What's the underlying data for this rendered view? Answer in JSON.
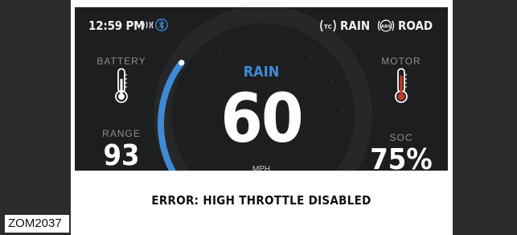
{
  "figure_id": "ZOM2037",
  "status_bar": {
    "time": "12:59 PM",
    "icons": [
      "heated-grips-icon",
      "bluetooth-icon"
    ],
    "traction_control": {
      "icon": "traction-control-icon",
      "icon_text": "TC",
      "mode": "RAIN"
    },
    "abs": {
      "icon": "abs-icon",
      "icon_text": "ABS",
      "mode": "ROAD"
    }
  },
  "battery": {
    "label": "BATTERY",
    "icon": "thermometer-icon"
  },
  "motor": {
    "label": "MOTOR",
    "icon": "thermometer-icon"
  },
  "range": {
    "label": "RANGE",
    "value": "93"
  },
  "soc": {
    "label": "SOC",
    "value": "75%"
  },
  "speedometer": {
    "ride_mode": "RAIN",
    "speed": "60",
    "unit": "MPH",
    "arc_fraction": 0.33
  },
  "error": {
    "message": "ERROR: HIGH THROTTLE DISABLED"
  },
  "colors": {
    "accent": "#3f8ad6",
    "screen_bg": "#1d1e20",
    "thermometer_fill": "#c0392b",
    "banner_bg": "#ffffff"
  }
}
